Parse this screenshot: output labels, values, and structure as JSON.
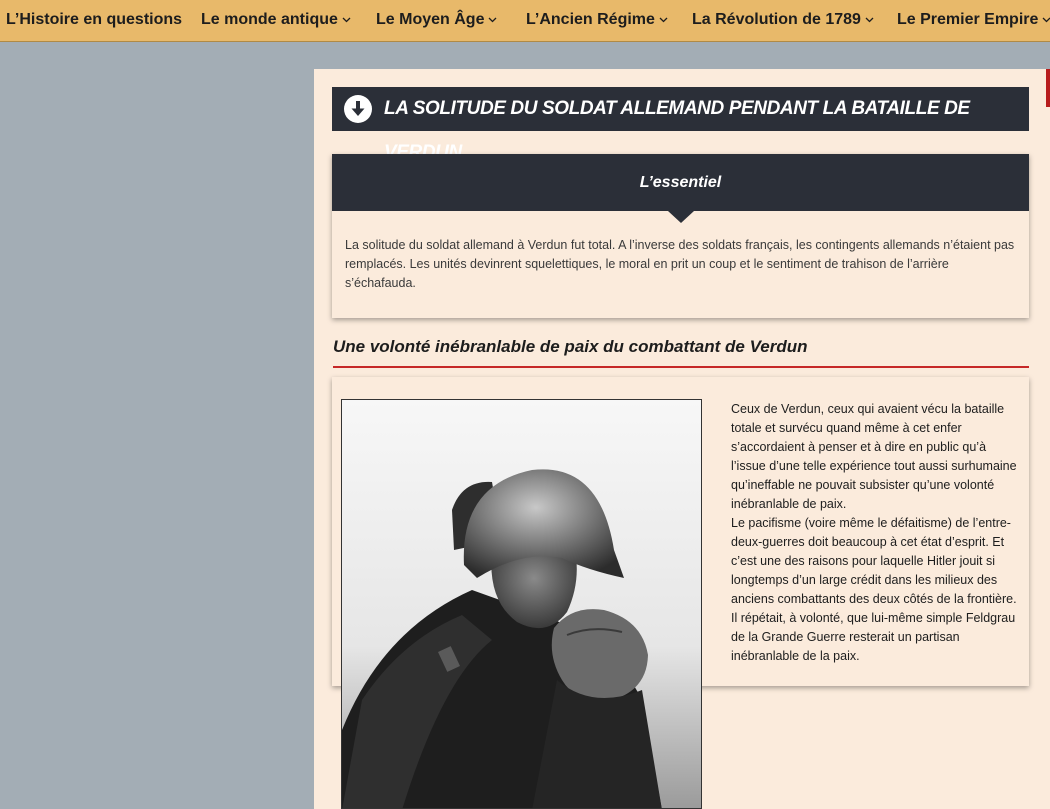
{
  "nav": {
    "items": [
      {
        "label": "L’Histoire en questions",
        "dropdown": false
      },
      {
        "label": "Le monde antique",
        "dropdown": true
      },
      {
        "label": "Le Moyen Âge",
        "dropdown": true
      },
      {
        "label": "L’Ancien Régime",
        "dropdown": true
      },
      {
        "label": "La Révolution de 1789",
        "dropdown": true
      },
      {
        "label": "Le Premier Empire",
        "dropdown": true
      }
    ]
  },
  "article": {
    "title": "LA SOLITUDE DU SOLDAT ALLEMAND PENDANT LA BATAILLE DE VERDUN",
    "title_icon": "arrow-down-circle-icon",
    "essential": {
      "heading": "L’essentiel",
      "text": "La solitude  du soldat allemand à Verdun fut total. A l’inverse des soldats français, les contingents allemands n’étaient pas remplacés. Les unités devinrent squelettiques, le moral en prit un coup et le sentiment de trahison de l’arrière s’échafauda."
    },
    "section": {
      "heading": "Une volonté inébranlable de paix du combattant de Verdun",
      "paragraphs": [
        "Ceux de Verdun, ceux qui avaient vécu la bataille totale et survécu quand même à cet enfer s’accordaient à penser et à dire en public qu’à l’issue d’une telle expérience tout aussi surhumaine qu’ineffable ne pouvait subsister qu’une volonté inébranlable de paix.",
        "Le pacifisme (voire même le défaitisme) de l’entre-deux-guerres doit beaucoup à cet état d’esprit. Et c’est une des raisons pour laquelle Hitler jouit si longtemps d’un large crédit dans les milieux des anciens combattants des deux côtés de la frontière. Il répétait, à volonté, que lui-même simple Feldgrau de la Grande Guerre resterait un partisan inébranlable de la paix."
      ]
    }
  },
  "colors": {
    "nav_bg": "#e8b96a",
    "page_bg": "#a3adb5",
    "panel_bg": "#fbebdc",
    "header_dark": "#2b2f38",
    "accent_red": "#c62828"
  }
}
